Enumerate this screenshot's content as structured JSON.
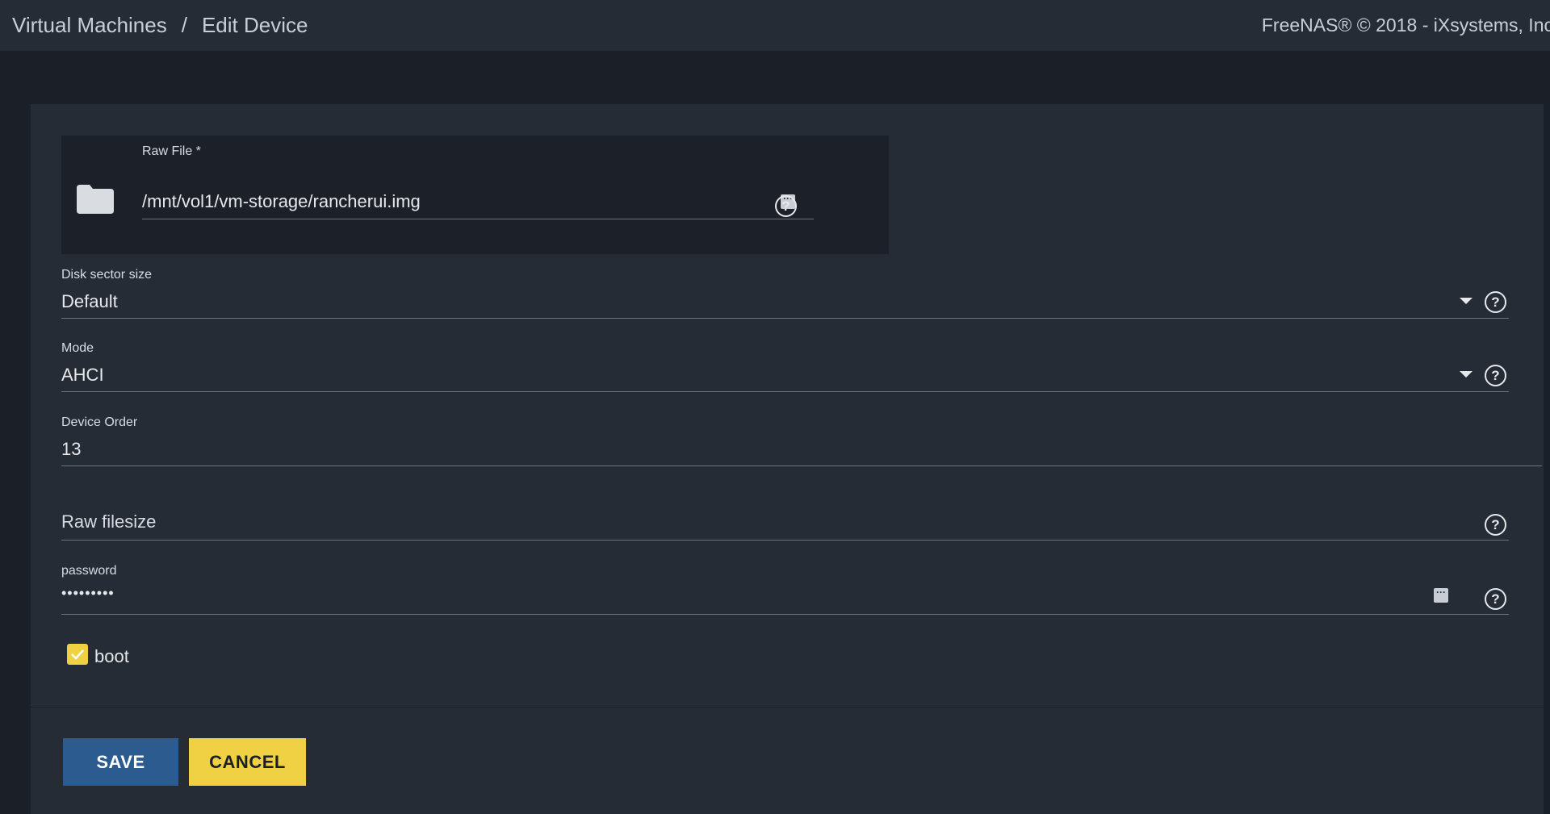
{
  "breadcrumb": {
    "items": [
      "Virtual Machines",
      "Edit Device"
    ],
    "separator": "/"
  },
  "copyright": "FreeNAS® © 2018 - iXsystems, Inc",
  "form": {
    "raw_file": {
      "label": "Raw File *",
      "value": "/mnt/vol1/vm-storage/rancherui.img"
    },
    "disk_sector_size": {
      "label": "Disk sector size",
      "value": "Default"
    },
    "mode": {
      "label": "Mode",
      "value": "AHCI"
    },
    "device_order": {
      "label": "Device Order",
      "value": "13"
    },
    "raw_filesize": {
      "placeholder": "Raw filesize"
    },
    "password": {
      "label": "password",
      "value": "•••••••••"
    },
    "boot": {
      "label": "boot",
      "checked": true
    }
  },
  "buttons": {
    "save": "SAVE",
    "cancel": "CANCEL"
  },
  "icons": {
    "help": "?",
    "ellipsis": "···"
  },
  "colors": {
    "accent_yellow": "#f0d144",
    "primary_blue": "#2b5b8f",
    "background": "#1b2028",
    "card": "#262c35"
  }
}
